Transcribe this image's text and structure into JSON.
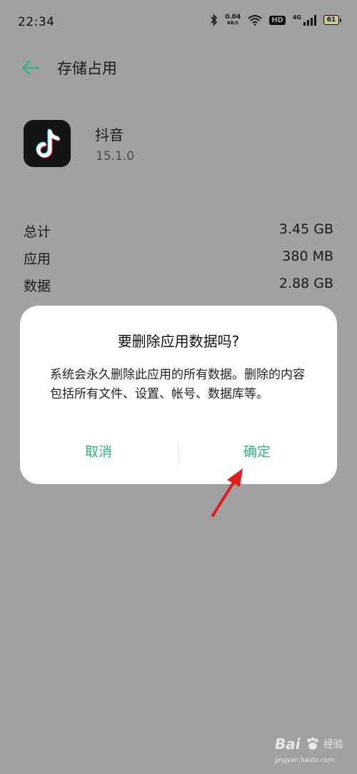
{
  "status_bar": {
    "time": "22:34",
    "net_speed_value": "0.04",
    "net_speed_unit": "KB/S",
    "hd_label": "HD",
    "cell_label": "4G",
    "battery_level": "61"
  },
  "header": {
    "title": "存储占用"
  },
  "app": {
    "name": "抖音",
    "version": "15.1.0"
  },
  "storage": {
    "rows": [
      {
        "label": "总计",
        "value": "3.45 GB"
      },
      {
        "label": "应用",
        "value": "380 MB"
      },
      {
        "label": "数据",
        "value": "2.88 GB"
      }
    ]
  },
  "dialog": {
    "title": "要删除应用数据吗?",
    "message": "系统会永久删除此应用的所有数据。删除的内容包括所有文件、设置、帐号、数据库等。",
    "cancel_label": "取消",
    "confirm_label": "确定"
  },
  "watermark": {
    "logo": "Bai",
    "text": "经验",
    "url": "jingyan.baidu.com"
  },
  "colors": {
    "accent": "#2db87d",
    "annotation_arrow": "#e0201f",
    "overlay_bg": "#a1a1a1"
  }
}
